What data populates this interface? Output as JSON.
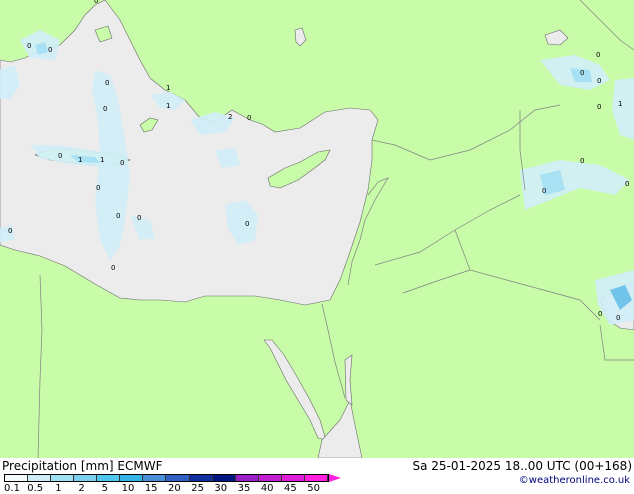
{
  "header": {
    "title": "Precipitation [mm]",
    "model": "ECMWF",
    "datetime": "Sa 25-01-2025 18..00 UTC (00+168)",
    "credit": "©weatheronline.co.uk"
  },
  "legend": {
    "ticks": [
      "0.1",
      "0.5",
      "1",
      "2",
      "5",
      "10",
      "15",
      "20",
      "25",
      "30",
      "35",
      "40",
      "45",
      "50"
    ],
    "colors": [
      "#f5fbfd",
      "#cdeef7",
      "#9fe0f2",
      "#7ad0ee",
      "#4ec6ee",
      "#34b4e8",
      "#4a90d6",
      "#3060c0",
      "#1030a0",
      "#001880",
      "#9a20c8",
      "#c020d0",
      "#e020d8",
      "#ff20e0"
    ]
  },
  "map": {
    "colors": {
      "land": "#c8fca8",
      "sea": "#ececec",
      "border": "#808080",
      "coast": "#6a6a6a",
      "precip_light": "#d0eef8",
      "precip_mid": "#a8e0f4",
      "precip_strong": "#70c4ea"
    },
    "value_labels": [
      "0",
      "0",
      "0",
      "0",
      "0",
      "0",
      "1",
      "0",
      "0",
      "1",
      "0",
      "2",
      "0",
      "0",
      "1",
      "1",
      "0",
      "0",
      "0",
      "0",
      "0",
      "0",
      "0",
      "0",
      "0",
      "0",
      "0",
      "1",
      "0"
    ]
  }
}
